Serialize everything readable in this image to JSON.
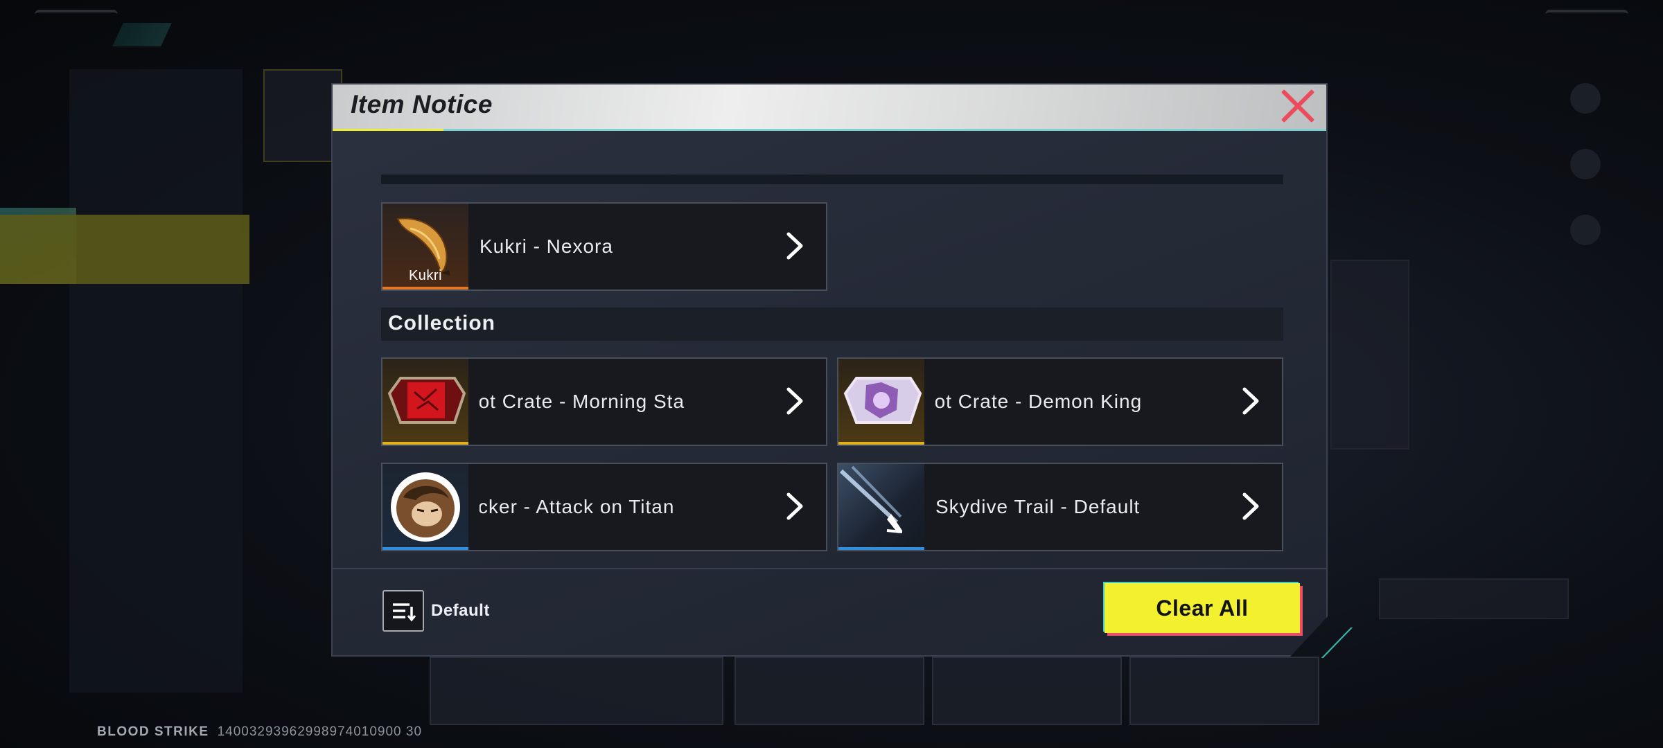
{
  "background": {
    "footer_brand": "BLOOD STRIKE",
    "footer_id": "14003293962998974010900 30"
  },
  "dialog": {
    "title": "Item Notice",
    "featured_item": {
      "thumb_label": "Kukri",
      "name": "Kukri - Nexora",
      "rarity_color": "#e07a2a"
    },
    "section_title": "Collection",
    "collection_items": [
      {
        "name": "Loot Crate - Morning Star",
        "visible_text": "oot Crate - Morning Sta",
        "rarity_color": "#e0b21f",
        "icon": "red-loot-crate-icon"
      },
      {
        "name": "Loot Crate - Demon King",
        "visible_text": "oot Crate - Demon King",
        "rarity_color": "#e0b21f",
        "icon": "purple-loot-crate-icon"
      },
      {
        "name": "Sticker - Attack on Titan",
        "visible_text": "ticker - Attack on Titan",
        "rarity_color": "#2e8fe0",
        "icon": "titan-sticker-icon"
      },
      {
        "name": "Skydive Trail - Default",
        "visible_text": "Skydive Trail - Default",
        "rarity_color": "#2e8fe0",
        "icon": "skydive-trail-icon"
      }
    ],
    "sort": {
      "label": "Default",
      "icon": "sort-icon"
    },
    "clear_all_label": "Clear All",
    "colors": {
      "accent_yellow": "#f3f02f",
      "accent_pink": "#ee4d66",
      "accent_teal": "#3ed1c2",
      "close_red": "#ec4b5c"
    }
  }
}
